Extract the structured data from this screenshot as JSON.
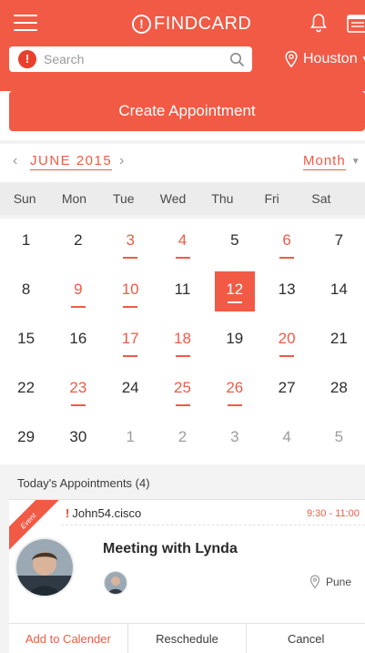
{
  "brand": {
    "name": "FINDCARD",
    "mark": "!",
    "accent": "#f15a45"
  },
  "search": {
    "placeholder": "Search",
    "alert_glyph": "!"
  },
  "location": {
    "city": "Houston"
  },
  "create_button": {
    "label": "Create Appointment"
  },
  "calendar": {
    "month_label": "JUNE 2015",
    "prev_glyph": "‹",
    "next_glyph": "›",
    "view_label": "Month",
    "weekdays": [
      "Sun",
      "Mon",
      "Tue",
      "Wed",
      "Thu",
      "Fri",
      "Sat"
    ],
    "weeks": [
      [
        {
          "d": "1"
        },
        {
          "d": "2"
        },
        {
          "d": "3",
          "event": true
        },
        {
          "d": "4",
          "event": true
        },
        {
          "d": "5"
        },
        {
          "d": "6",
          "event": true
        },
        {
          "d": "7"
        }
      ],
      [
        {
          "d": "8"
        },
        {
          "d": "9",
          "event": true
        },
        {
          "d": "10",
          "event": true
        },
        {
          "d": "11"
        },
        {
          "d": "12",
          "selected": true
        },
        {
          "d": "13"
        },
        {
          "d": "14"
        }
      ],
      [
        {
          "d": "15"
        },
        {
          "d": "16"
        },
        {
          "d": "17",
          "event": true
        },
        {
          "d": "18",
          "event": true
        },
        {
          "d": "19"
        },
        {
          "d": "20",
          "event": true
        },
        {
          "d": "21"
        }
      ],
      [
        {
          "d": "22"
        },
        {
          "d": "23",
          "event": true
        },
        {
          "d": "24"
        },
        {
          "d": "25",
          "event": true
        },
        {
          "d": "26",
          "event": true
        },
        {
          "d": "27"
        },
        {
          "d": "28"
        }
      ],
      [
        {
          "d": "29"
        },
        {
          "d": "30"
        },
        {
          "d": "1",
          "other": true
        },
        {
          "d": "2",
          "other": true
        },
        {
          "d": "3",
          "other": true
        },
        {
          "d": "4",
          "other": true
        },
        {
          "d": "5",
          "other": true
        }
      ]
    ]
  },
  "appointments": {
    "header": "Today's Appointments (4)",
    "items": [
      {
        "badge": "Event",
        "user": "John54.cisco",
        "time": "9:30 - 11:00",
        "title": "Meeting with Lynda",
        "location": "Pune",
        "actions": [
          "Add to Calender",
          "Reschedule",
          "Cancel"
        ]
      }
    ]
  }
}
